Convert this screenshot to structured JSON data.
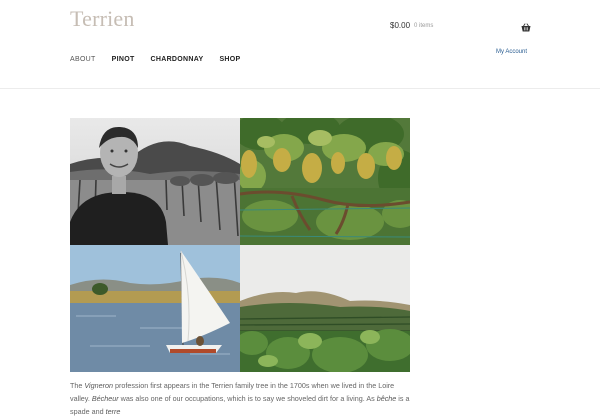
{
  "header": {
    "site_title": "Terrien",
    "cart_total": "$0.00",
    "cart_count": "0 items",
    "account_label": "My Account"
  },
  "nav": {
    "items": [
      {
        "label": "ABOUT"
      },
      {
        "label": "PINOT"
      },
      {
        "label": "CHARDONNAY"
      },
      {
        "label": "SHOP"
      }
    ]
  },
  "gallery": {
    "photos": [
      {
        "icon": "vintner-portrait-photo"
      },
      {
        "icon": "grape-clusters-photo"
      },
      {
        "icon": "sailboat-lake-photo"
      },
      {
        "icon": "vineyard-hills-photo"
      }
    ]
  },
  "intro": {
    "t1": "The ",
    "vigneron": "Vigneron",
    "t2": " profession first appears in the Terrien family tree in the 1700s when we lived in the Loire valley.",
    "becheur": "Bécheur",
    "t3": " was also one of our occupations, which is to say we shoveled dirt for a living. As ",
    "beche": "bêche",
    "t4": " is a spade and ",
    "terre": "terre"
  }
}
